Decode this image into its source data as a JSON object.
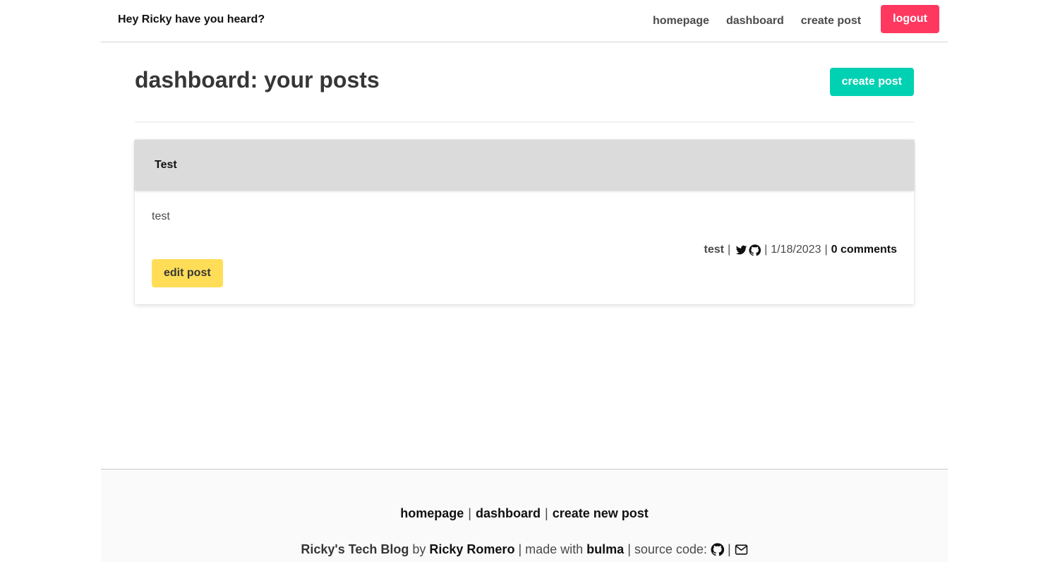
{
  "navbar": {
    "brand": "Hey Ricky have you heard?",
    "links": [
      "homepage",
      "dashboard",
      "create post"
    ],
    "logout_label": "logout"
  },
  "header": {
    "title": "dashboard: your posts",
    "create_label": "create post"
  },
  "post": {
    "title": "Test",
    "content": "test",
    "author": "test",
    "date": "1/18/2023",
    "comments": "0 comments",
    "edit_label": "edit post",
    "separator": "|",
    "icons": [
      "twitter-icon",
      "github-icon"
    ]
  },
  "footer": {
    "links": [
      "homepage",
      "dashboard",
      "create new post"
    ],
    "separator": "|",
    "blog_name": "Ricky's Tech Blog",
    "by_text": "by",
    "author_name": "Ricky Romero",
    "made_with_text": "made with",
    "framework": "bulma",
    "source_code_text": "source code:",
    "icons": [
      "github-icon",
      "envelope-icon"
    ]
  },
  "colors": {
    "logout": "#ff3860",
    "create": "#00d1b2",
    "edit": "#ffdd57",
    "card_header": "#dbdbdb",
    "footer_bg": "#fafafa"
  }
}
